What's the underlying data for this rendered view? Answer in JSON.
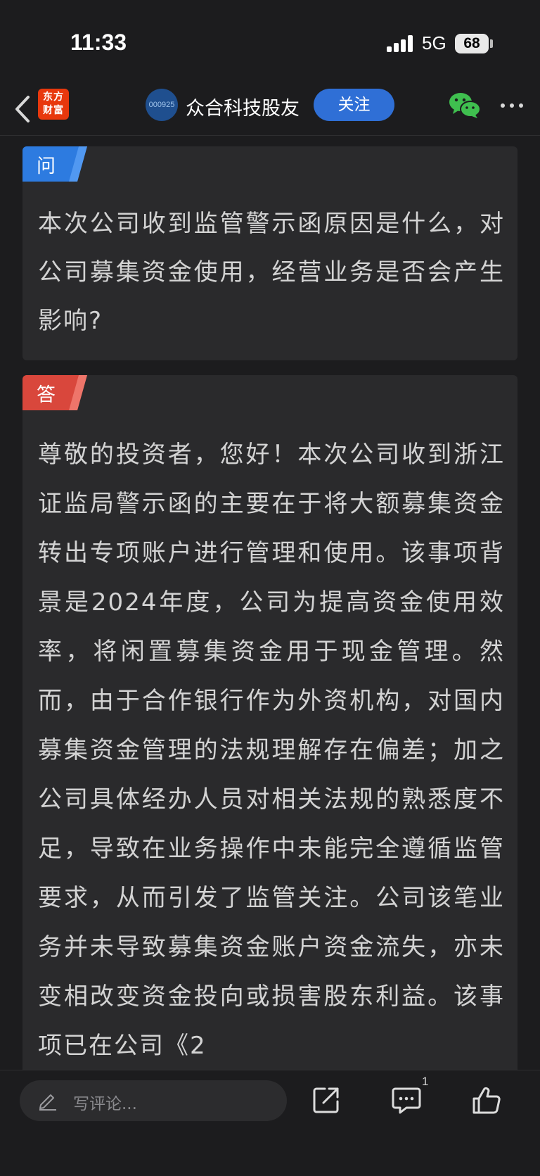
{
  "status_bar": {
    "time": "11:33",
    "network": "5G",
    "battery": "68"
  },
  "nav": {
    "logo_text": "东方财富",
    "avatar_text": "000925",
    "title": "众合科技股友",
    "follow_label": "关注"
  },
  "question": {
    "tag": "问",
    "text": "本次公司收到监管警示函原因是什么，对公司募集资金使用，经营业务是否会产生影响?"
  },
  "answer": {
    "tag": "答",
    "text": "尊敬的投资者，您好！本次公司收到浙江证监局警示函的主要在于将大额募集资金转出专项账户进行管理和使用。该事项背景是2024年度，公司为提高资金使用效率，将闲置募集资金用于现金管理。然而，由于合作银行作为外资机构，对国内募集资金管理的法规理解存在偏差；加之公司具体经办人员对相关法规的熟悉度不足，导致在业务操作中未能完全遵循监管要求，从而引发了监管关注。公司该笔业务并未导致募集资金账户资金流失，亦未变相改变资金投向或损害股东利益。该事项已在公司《2"
  },
  "bottom_bar": {
    "comment_placeholder": "写评论...",
    "comment_count": "1"
  },
  "colors": {
    "background": "#1c1c1e",
    "card": "#2a2a2c",
    "question_tag": "#2d7be0",
    "answer_tag": "#d9473c",
    "follow_button": "#2f6fd6",
    "wechat": "#3fbf4f"
  }
}
